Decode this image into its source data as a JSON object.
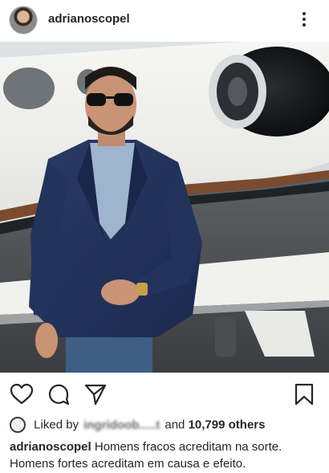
{
  "post": {
    "username": "adrianoscopel",
    "more_icon": "more-vertical-icon"
  },
  "actions": {
    "like_icon": "heart-icon",
    "comment_icon": "comment-icon",
    "share_icon": "send-icon",
    "save_icon": "bookmark-icon"
  },
  "likes": {
    "prefix": "Liked by",
    "liker": "ingridoob.....t",
    "connector": "and",
    "others": "10,799 others"
  },
  "caption": {
    "username": "adrianoscopel",
    "text": "Homens fracos acreditam na sorte. Homens fortes acreditam em causa e efeito."
  }
}
